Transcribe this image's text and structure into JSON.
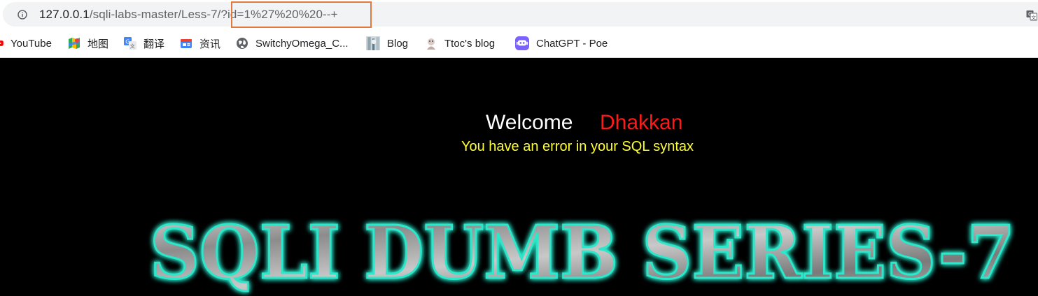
{
  "browser": {
    "url_base": "127.0.0.1",
    "url_path": "/sqli-labs-master/Less-7/",
    "url_query": "?id=1%27%20%20--+",
    "icons": {
      "site_info": "info-icon",
      "translate": "translate-icon"
    },
    "highlight_color": "#e07a3f"
  },
  "bookmarks": [
    {
      "label": "YouTube",
      "icon": "youtube-icon"
    },
    {
      "label": "地图",
      "icon": "maps-icon"
    },
    {
      "label": "翻译",
      "icon": "translate-app-icon"
    },
    {
      "label": "资讯",
      "icon": "news-icon"
    },
    {
      "label": "SwitchyOmega_C...",
      "icon": "globe-icon"
    },
    {
      "label": "Blog",
      "icon": "blog-avatar-icon"
    },
    {
      "label": "Ttoc's blog",
      "icon": "ttoc-avatar-icon"
    },
    {
      "label": "ChatGPT - Poe",
      "icon": "poe-icon"
    }
  ],
  "page": {
    "welcome": "Welcome",
    "name": "Dhakkan",
    "error": "You have an error in your SQL syntax",
    "logo_text": "SQLI DUMB SERIES-7",
    "colors": {
      "background": "#000000",
      "welcome": "#ffffff",
      "name": "#ff1a1a",
      "error": "#ffff33",
      "logo_glow": "#2ee6c9"
    }
  }
}
